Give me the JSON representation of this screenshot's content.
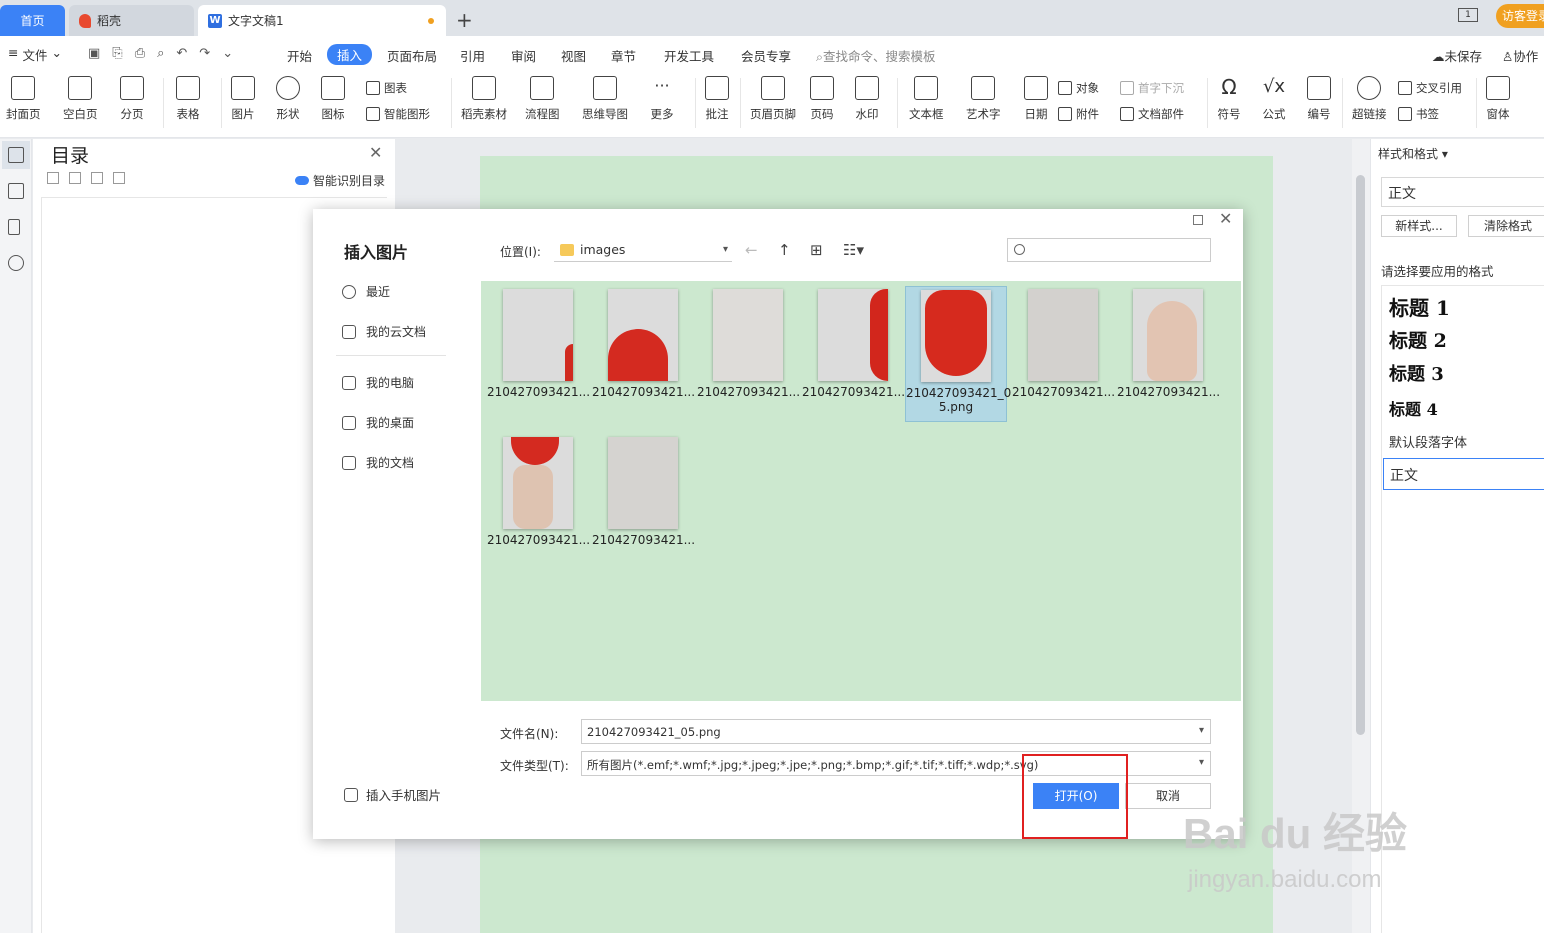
{
  "tabs": {
    "home": "首页",
    "daoke": "稻壳",
    "doc": "文字文稿1",
    "guest": "访客登录"
  },
  "menu": {
    "file": "文件",
    "items": [
      "开始",
      "插入",
      "页面布局",
      "引用",
      "审阅",
      "视图",
      "章节",
      "开发工具",
      "会员专享"
    ],
    "active": "插入",
    "search": "查找命令、搜索模板",
    "unsaved": "未保存",
    "collab": "协作"
  },
  "ribbon": {
    "cover": "封面页",
    "blank": "空白页",
    "pagebreak": "分页",
    "table": "表格",
    "picture": "图片",
    "shape": "形状",
    "icon": "图标",
    "chart": "图表",
    "smartart": "智能图形",
    "materials": "稻壳素材",
    "flowchart": "流程图",
    "mindmap": "思维导图",
    "more": "更多",
    "comment": "批注",
    "headerfooter": "页眉页脚",
    "pagenum": "页码",
    "watermark": "水印",
    "textbox": "文本框",
    "wordart": "艺术字",
    "date": "日期",
    "object": "对象",
    "attachment": "附件",
    "dropcap": "首字下沉",
    "docparts": "文档部件",
    "symbol": "符号",
    "formula": "公式",
    "numbering": "编号",
    "hyperlink": "超链接",
    "crossref": "交叉引用",
    "bookmark": "书签",
    "window": "窗体"
  },
  "toc": {
    "title": "目录",
    "smart": "智能识别目录"
  },
  "right_panel": {
    "title": "样式和格式",
    "current": "正文",
    "new_style": "新样式...",
    "clear": "清除格式",
    "hint": "请选择要应用的格式",
    "styles": [
      "标题 1",
      "标题 2",
      "标题 3",
      "标题 4"
    ],
    "default_font": "默认段落字体",
    "selected": "正文"
  },
  "dialog": {
    "title": "插入图片",
    "nav": {
      "recent": "最近",
      "cloud": "我的云文档",
      "pc": "我的电脑",
      "desktop": "我的桌面",
      "docs": "我的文档",
      "phone": "插入手机图片"
    },
    "location_label": "位置(I):",
    "folder": "images",
    "files": [
      "210427093421...",
      "210427093421...",
      "210427093421...",
      "210427093421...",
      "210427093421_05.png",
      "210427093421...",
      "210427093421...",
      "210427093421...",
      "210427093421..."
    ],
    "selected_lines": [
      "210427093421_0",
      "5.png"
    ],
    "filename_label": "文件名(N):",
    "filename": "210427093421_05.png",
    "filetype_label": "文件类型(T):",
    "filetype": "所有图片(*.emf;*.wmf;*.jpg;*.jpeg;*.jpe;*.png;*.bmp;*.gif;*.tif;*.tiff;*.wdp;*.svg)",
    "open": "打开(O)",
    "cancel": "取消"
  },
  "watermark": {
    "brand": "Bai  du 经验",
    "url": "jingyan.baidu.com"
  }
}
